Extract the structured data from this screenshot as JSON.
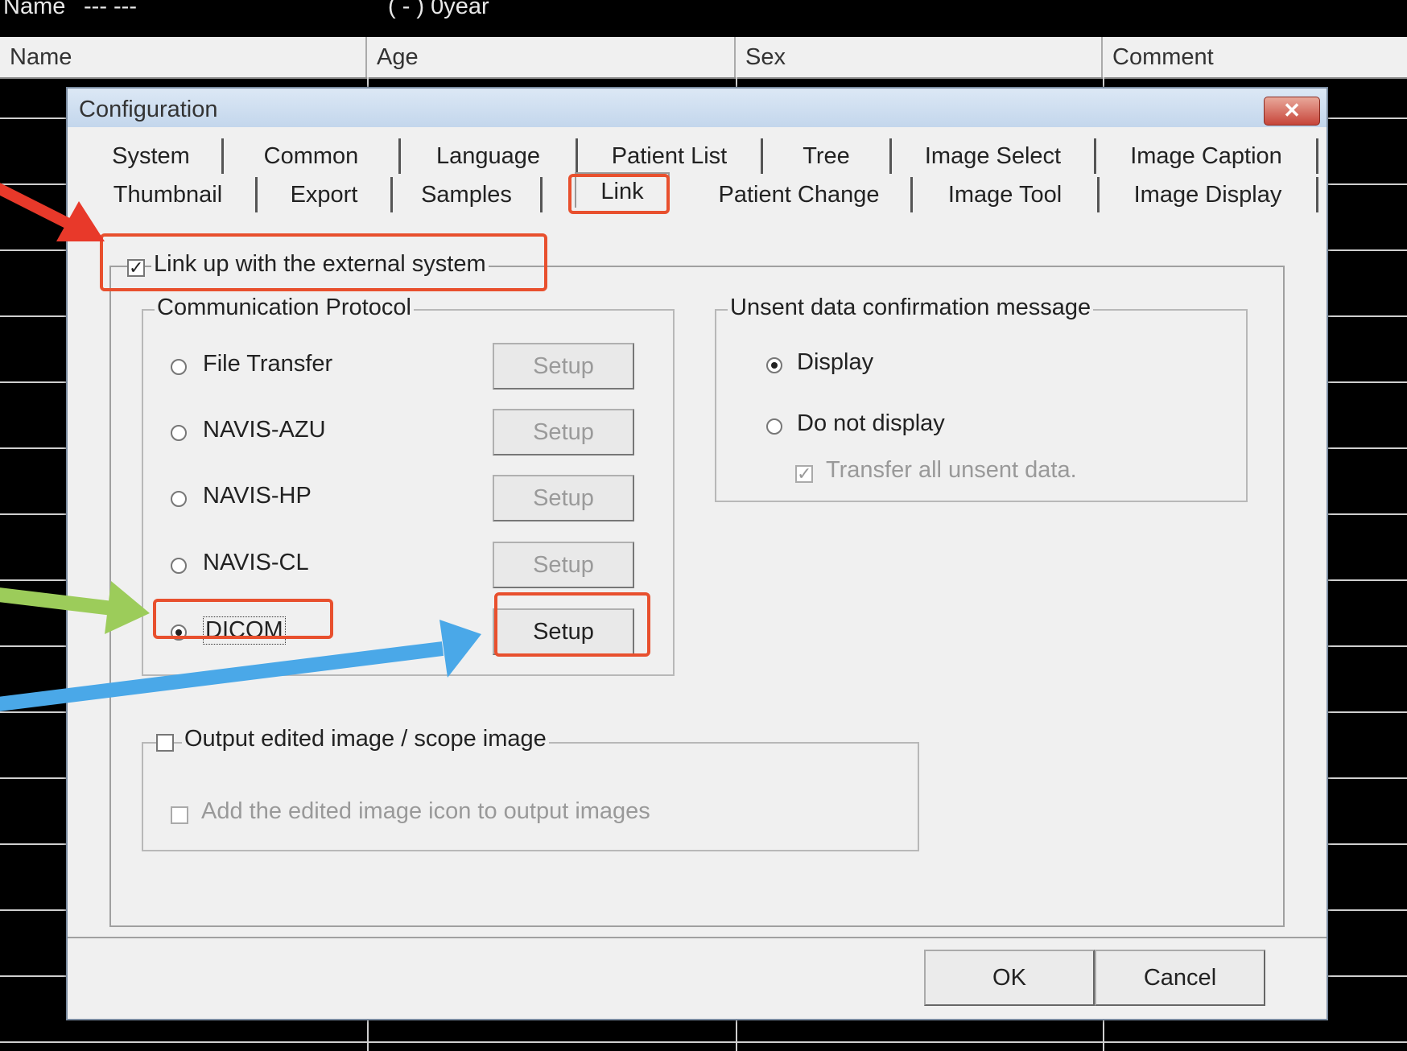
{
  "topbar": {
    "name_label": "Name",
    "name_value": "--- ---",
    "age_info": "( - )  0year"
  },
  "columns": [
    "Name",
    "Age",
    "Sex",
    "Comment"
  ],
  "dialog": {
    "title": "Configuration",
    "close_symbol": "✕",
    "tabs_row1": [
      "System",
      "Common",
      "Language",
      "Patient List",
      "Tree",
      "Image Select",
      "Image Caption"
    ],
    "tabs_row2": [
      "Thumbnail",
      "Export",
      "Samples",
      "Link",
      "Patient Change",
      "Image Tool",
      "Image Display"
    ],
    "active_tab": "Link",
    "link_checkbox": {
      "label": "Link up with the external system",
      "checked": true
    },
    "protocol": {
      "title": "Communication Protocol",
      "options": [
        {
          "label": "File Transfer",
          "selected": false,
          "setup": "Setup",
          "enabled": false
        },
        {
          "label": "NAVIS-AZU",
          "selected": false,
          "setup": "Setup",
          "enabled": false
        },
        {
          "label": "NAVIS-HP",
          "selected": false,
          "setup": "Setup",
          "enabled": false
        },
        {
          "label": "NAVIS-CL",
          "selected": false,
          "setup": "Setup",
          "enabled": false
        },
        {
          "label": "DICOM",
          "selected": true,
          "setup": "Setup",
          "enabled": true
        }
      ]
    },
    "unsent": {
      "title": "Unsent data confirmation message",
      "display": "Display",
      "do_not_display": "Do not display",
      "transfer_all": "Transfer all unsent data."
    },
    "output": {
      "label": "Output edited image / scope image",
      "add_icon": "Add the edited image icon to output images"
    },
    "ok": "OK",
    "cancel": "Cancel"
  },
  "colors": {
    "highlight": "#e8502e",
    "arrow_red": "#e8392a",
    "arrow_green": "#9ccc5a",
    "arrow_blue": "#4aa8e8"
  }
}
